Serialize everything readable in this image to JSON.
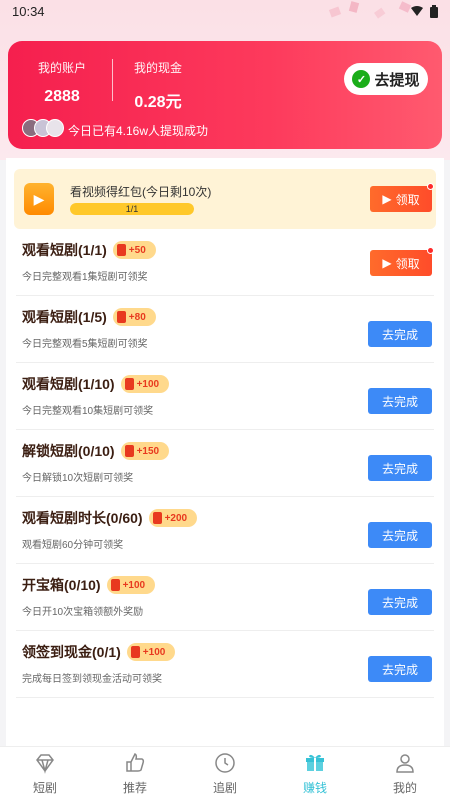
{
  "status_bar": {
    "time": "10:34"
  },
  "account": {
    "account_label": "我的账户",
    "account_value": "2888",
    "cash_label": "我的现金",
    "cash_value": "0.28元",
    "withdraw_label": "去提现",
    "social_proof": "今日已有4.16w人提现成功"
  },
  "video_banner": {
    "title": "看视频得红包(今日剩10次)",
    "progress_text": "1/1",
    "progress": 1.0,
    "button_label": "领取"
  },
  "tasks": [
    {
      "title": "观看短剧(1/1)",
      "reward": "+50",
      "desc": "今日完整观看1集短剧可领奖",
      "button": "领取",
      "style": "orange"
    },
    {
      "title": "观看短剧(1/5)",
      "reward": "+80",
      "desc": "今日完整观看5集短剧可领奖",
      "button": "去完成",
      "style": "blue"
    },
    {
      "title": "观看短剧(1/10)",
      "reward": "+100",
      "desc": "今日完整观看10集短剧可领奖",
      "button": "去完成",
      "style": "blue"
    },
    {
      "title": "解锁短剧(0/10)",
      "reward": "+150",
      "desc": "今日解锁10次短剧可领奖",
      "button": "去完成",
      "style": "blue"
    },
    {
      "title": "观看短剧时长(0/60)",
      "reward": "+200",
      "desc": "观看短剧60分钟可领奖",
      "button": "去完成",
      "style": "blue"
    },
    {
      "title": "开宝箱(0/10)",
      "reward": "+100",
      "desc": "今日开10次宝箱领额外奖励",
      "button": "去完成",
      "style": "blue"
    },
    {
      "title": "领签到现金(0/1)",
      "reward": "+100",
      "desc": "完成每日签到领现金活动可领奖",
      "button": "去完成",
      "style": "blue"
    }
  ],
  "tab_bar": {
    "tabs": [
      {
        "label": "短剧",
        "icon": "diamond-icon"
      },
      {
        "label": "推荐",
        "icon": "thumbs-up-icon"
      },
      {
        "label": "追剧",
        "icon": "clock-icon"
      },
      {
        "label": "赚钱",
        "icon": "gift-icon",
        "active": true
      },
      {
        "label": "我的",
        "icon": "profile-icon"
      }
    ]
  },
  "colors": {
    "accent_red": "#f51f4e",
    "blue_button": "#3d8af7",
    "active_tab": "#36c2d6"
  }
}
